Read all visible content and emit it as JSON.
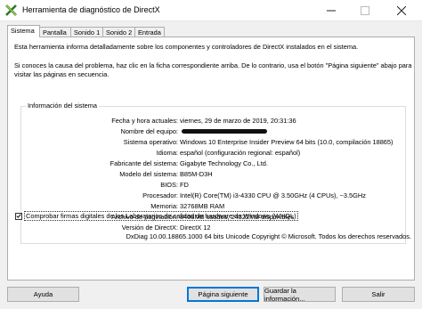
{
  "window": {
    "title": "Herramienta de diagnóstico de DirectX",
    "controls": [
      "minimize-icon",
      "maximize-icon",
      "close-icon"
    ]
  },
  "tabs": [
    {
      "label": "Sistema",
      "active": true
    },
    {
      "label": "Pantalla",
      "active": false
    },
    {
      "label": "Sonido 1",
      "active": false
    },
    {
      "label": "Sonido 2",
      "active": false
    },
    {
      "label": "Entrada",
      "active": false
    }
  ],
  "intro": {
    "line1": "Esta herramienta informa detalladamente sobre los componentes y controladores de DirectX instalados en el sistema.",
    "line2": "Si conoces la causa del problema, haz clic en la ficha correspondiente arriba. De lo contrario, usa el botón \"Página siguiente\" abajo para",
    "line3": "visitar las páginas en secuencia."
  },
  "system_info": {
    "group_title": "Información del sistema",
    "rows": [
      {
        "label": "Fecha y hora actuales:",
        "value": "viernes, 29 de marzo de 2019, 20:31:36"
      },
      {
        "label": "Nombre del equipo:",
        "value": ""
      },
      {
        "label": "Sistema operativo:",
        "value": "Windows 10 Enterprise Insider Preview 64 bits (10.0, compilación 18865)"
      },
      {
        "label": "Idioma:",
        "value": "español (configuración regional: español)"
      },
      {
        "label": "Fabricante del sistema:",
        "value": "Gigabyte Technology Co., Ltd."
      },
      {
        "label": "Modelo del sistema:",
        "value": "B85M-D3H"
      },
      {
        "label": "BIOS:",
        "value": "FD"
      },
      {
        "label": "Procesador:",
        "value": "Intel(R) Core(TM) i3-4330 CPU @ 3.50GHz (4 CPUs), ~3.5GHz"
      },
      {
        "label": "Memoria:",
        "value": "32768MB RAM"
      },
      {
        "label": "Archivo de paginación:",
        "value": "8408MB usados, 24322MB disponibles"
      },
      {
        "label": "Versión de DirectX:",
        "value": "DirectX 12"
      }
    ]
  },
  "whql": {
    "label": "Comprobar firmas digitales de los Laboratorios de calidad de hardware de Windows (WHQL)",
    "checked": true
  },
  "footer": "DxDiag 10.00.18865.1000 64 bits Unicode  Copyright © Microsoft. Todos los derechos reservados.",
  "buttons": {
    "help": "Ayuda",
    "next": "Página siguiente",
    "save": "Guardar la información...",
    "exit": "Salir"
  },
  "colors": {
    "accent": "#0078d7",
    "window_bg": "#f0f0f0",
    "panel_bg": "#ffffff",
    "button_bg": "#e1e1e1"
  }
}
